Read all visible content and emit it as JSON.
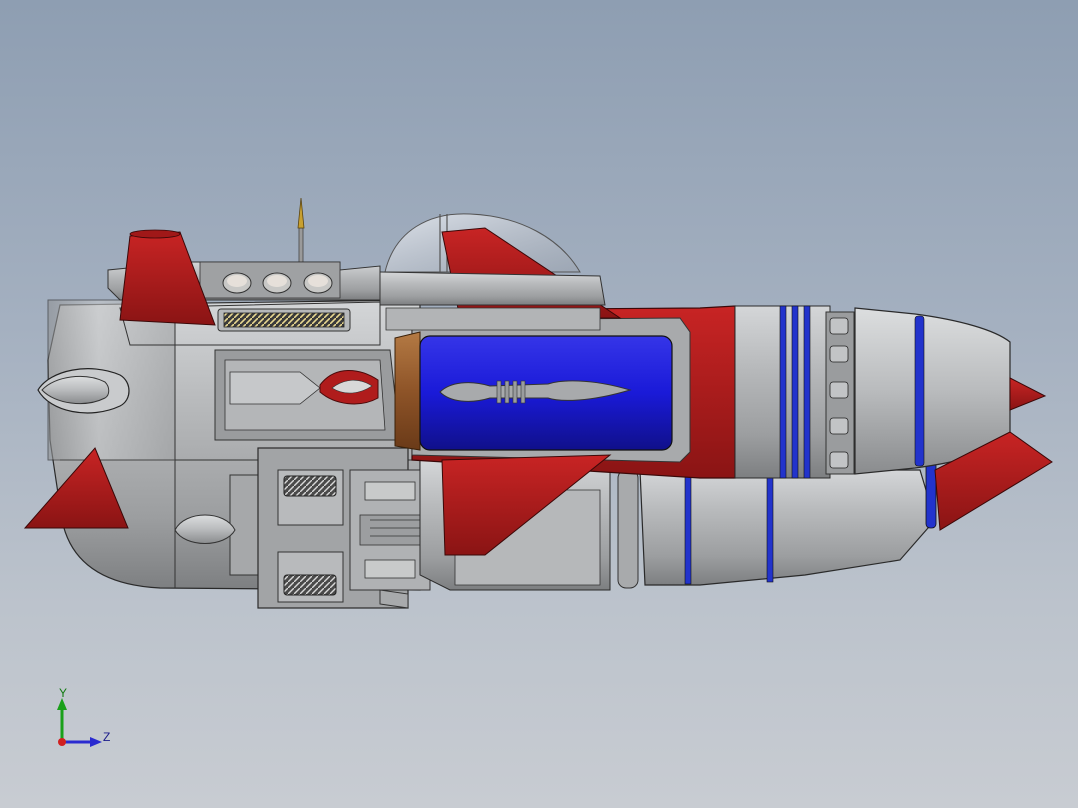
{
  "viewport": {
    "background_top": "#8e9eb2",
    "background_bottom": "#c8ccd2"
  },
  "model": {
    "body_color": "#a9abad",
    "fin_color": "#b01c1c",
    "core_color": "#1c1ccf",
    "accent_ring_color": "#2233cc",
    "canopy_color": "#c8cdd4",
    "bronze_color": "#9a5a2a"
  },
  "triad": {
    "y_label": "Y",
    "z_label": "Z",
    "y_color": "#1aa01a",
    "z_color": "#2a2ad0",
    "x_color": "#d02020"
  }
}
